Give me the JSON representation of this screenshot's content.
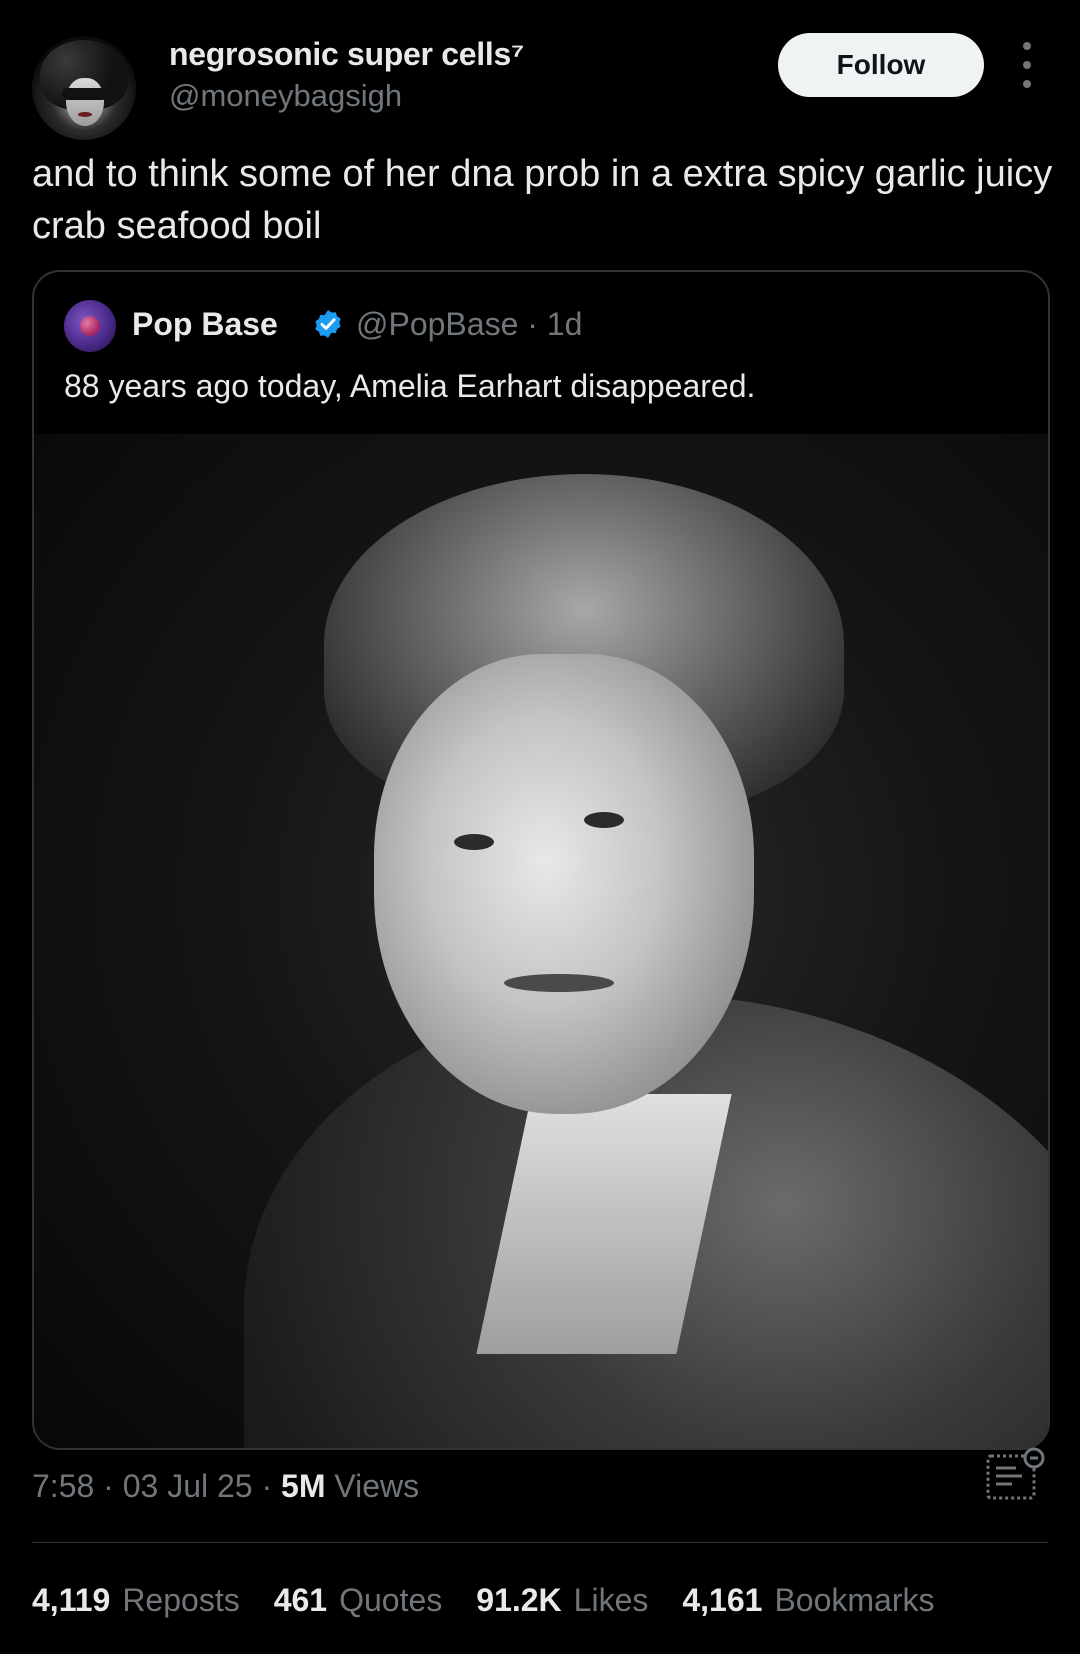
{
  "author": {
    "display_name": "negrosonic super cells⁷",
    "handle": "@moneybagsigh"
  },
  "follow_label": "Follow",
  "more_icon": "more-vertical-icon",
  "tweet_text": "and to think some of her dna prob in a extra spicy garlic juicy crab seafood boil",
  "quote": {
    "name": "Pop Base",
    "verified_icon": "verified-badge-icon",
    "verified_color": "#1d9bf0",
    "handle_time": "@PopBase · 1d",
    "text": "88 years ago today, Amelia Earhart disappeared."
  },
  "meta": {
    "time_date": "7:58 · 03 Jul 25 · ",
    "views_count": "5M",
    "views_label": " Views"
  },
  "stats_icon": "post-analytics-icon",
  "engagement": [
    {
      "count": "4,119",
      "label": "Reposts"
    },
    {
      "count": "461",
      "label": "Quotes"
    },
    {
      "count": "91.2K",
      "label": "Likes"
    },
    {
      "count": "4,161",
      "label": "Bookmarks"
    }
  ]
}
